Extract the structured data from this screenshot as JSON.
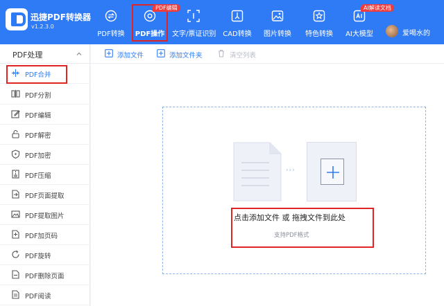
{
  "app": {
    "title": "迅捷PDF转换器",
    "version": "v1.2.3.0"
  },
  "nav": [
    {
      "id": "pdf-convert",
      "label": "PDF转换",
      "icon": "swap-circle-icon"
    },
    {
      "id": "pdf-operate",
      "label": "PDF操作",
      "icon": "gear-icon",
      "active": true,
      "badge": "PDF编辑"
    },
    {
      "id": "ocr",
      "label": "文字/票证识别",
      "icon": "scan-text-icon"
    },
    {
      "id": "cad",
      "label": "CAD转换",
      "icon": "cad-icon"
    },
    {
      "id": "image",
      "label": "图片转换",
      "icon": "image-icon"
    },
    {
      "id": "special",
      "label": "特色转换",
      "icon": "star-swap-icon"
    },
    {
      "id": "ai",
      "label": "AI大模型",
      "icon": "ai-icon",
      "badge": "AI解读文档"
    }
  ],
  "user": {
    "name": "爱喝水的"
  },
  "sidebar": {
    "header": "PDF处理",
    "items": [
      {
        "label": "PDF合并",
        "icon": "merge-icon",
        "active": true
      },
      {
        "label": "PDF分割",
        "icon": "split-icon"
      },
      {
        "label": "PDF编辑",
        "icon": "edit-icon"
      },
      {
        "label": "PDF解密",
        "icon": "unlock-icon"
      },
      {
        "label": "PDF加密",
        "icon": "shield-icon"
      },
      {
        "label": "PDF压缩",
        "icon": "compress-icon"
      },
      {
        "label": "PDF页面提取",
        "icon": "extract-page-icon"
      },
      {
        "label": "PDF提取图片",
        "icon": "extract-image-icon"
      },
      {
        "label": "PDF加页码",
        "icon": "page-number-icon"
      },
      {
        "label": "PDF旋转",
        "icon": "rotate-icon"
      },
      {
        "label": "PDF删除页面",
        "icon": "delete-page-icon"
      },
      {
        "label": "PDF阅读",
        "icon": "read-icon"
      }
    ]
  },
  "toolbar": {
    "add_file": "添加文件",
    "add_folder": "添加文件夹",
    "clear_list": "清空列表"
  },
  "dropzone": {
    "title": "点击添加文件 或 拖拽文件到此处",
    "subtitle": "支持PDF格式",
    "arrows": "›››"
  },
  "colors": {
    "primary": "#2f7bf5",
    "highlight": "#e02424",
    "badge": "#ef3b3b"
  }
}
